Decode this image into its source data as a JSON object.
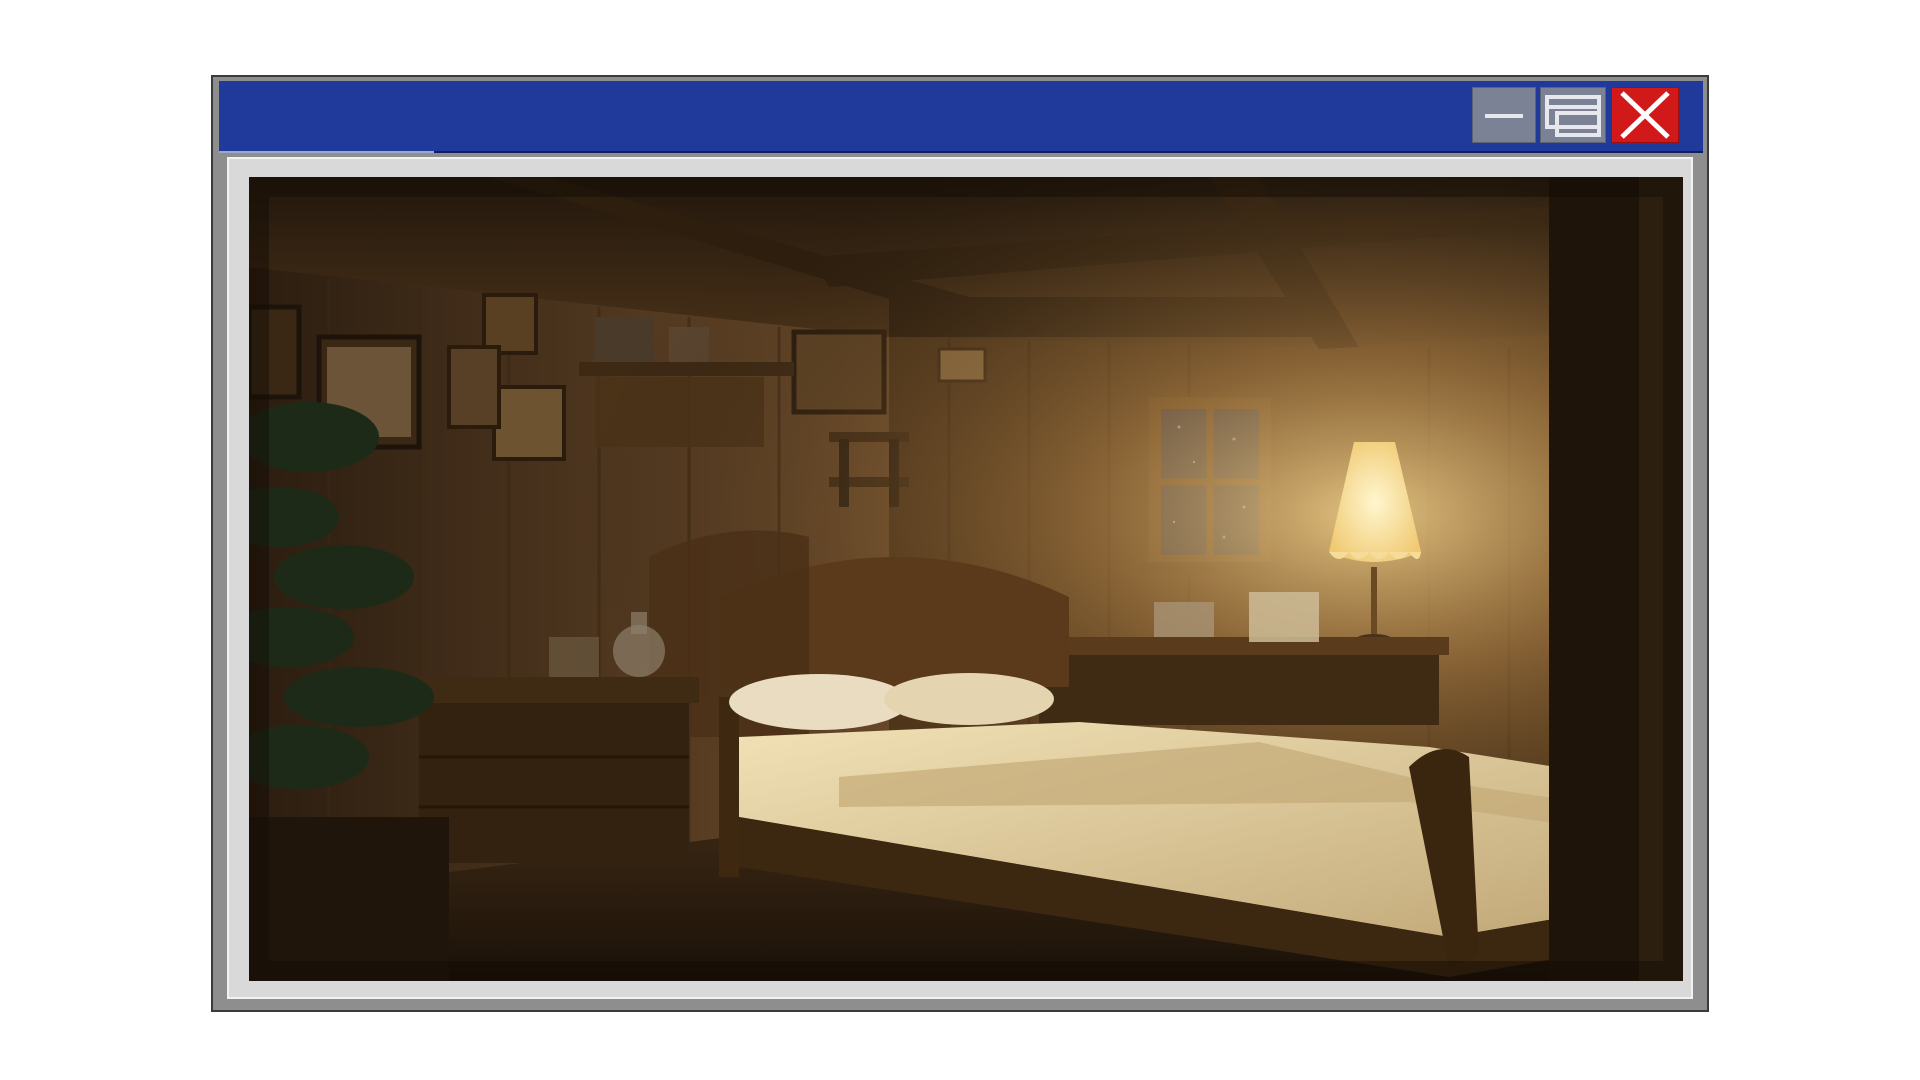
{
  "window": {
    "title": "",
    "controls": {
      "minimize_icon": "minimize-icon",
      "maximize_icon": "restore-icon",
      "close_icon": "close-icon"
    },
    "colors": {
      "titlebar": "#1f3a9a",
      "close_button": "#d2191a",
      "control_button": "#7c8296",
      "frame": "#d9d9d9"
    }
  },
  "scene": {
    "description_icon": "illustration",
    "palette": {
      "wall": "#6b4a2a",
      "lamp_glow": "#ffe9a8",
      "bed_sheet": "#e8d6a8",
      "night_sky": "#2d3447"
    }
  }
}
